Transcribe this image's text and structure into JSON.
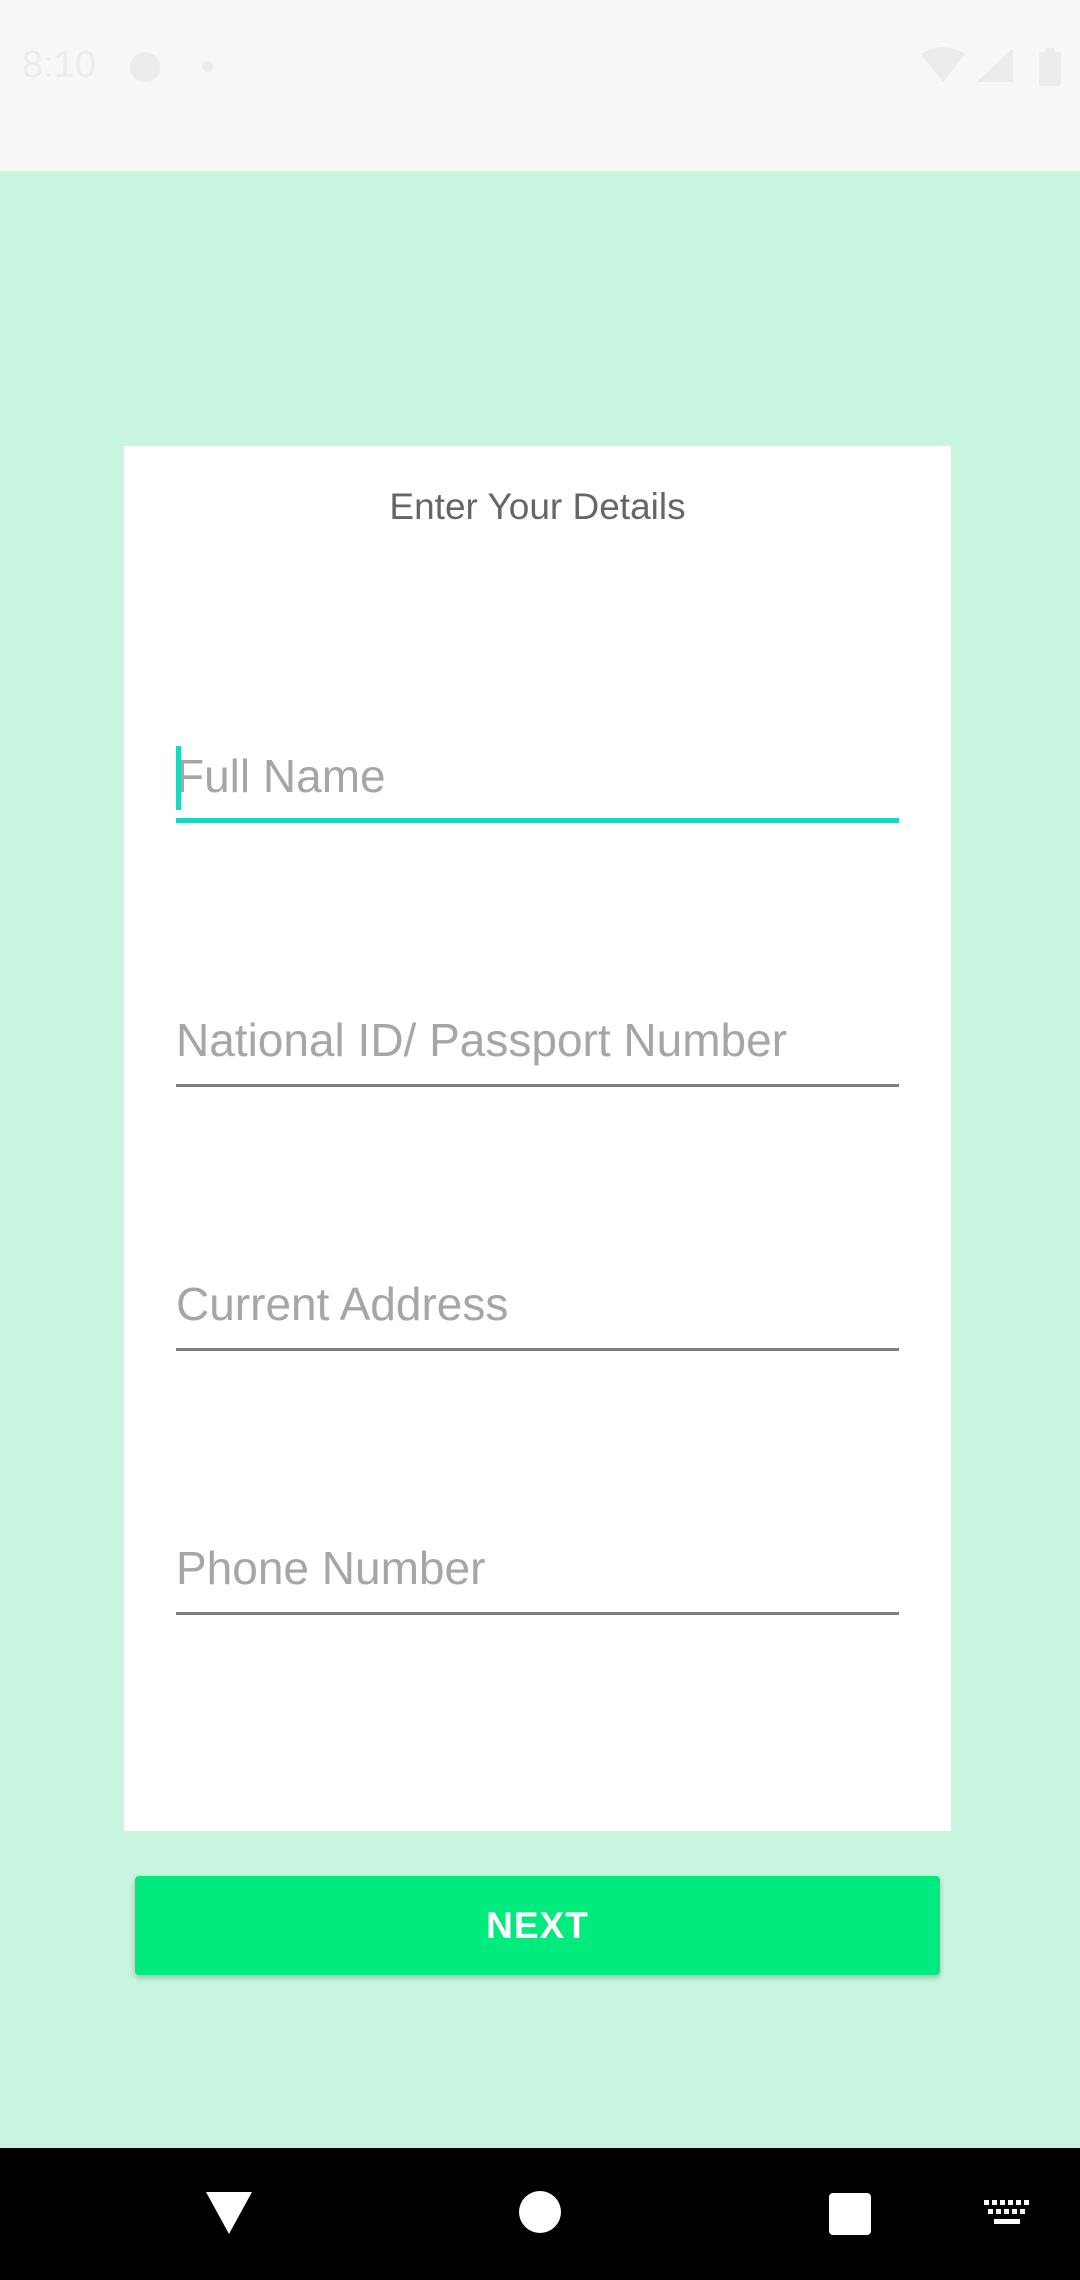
{
  "status_bar": {
    "time": "8:10"
  },
  "form": {
    "title": "Enter Your Details",
    "fields": [
      {
        "placeholder": "Full Name",
        "value": ""
      },
      {
        "placeholder": "National ID/ Passport Number",
        "value": ""
      },
      {
        "placeholder": "Current Address",
        "value": ""
      },
      {
        "placeholder": "Phone Number",
        "value": ""
      }
    ],
    "next_label": "NEXT"
  },
  "colors": {
    "background": "#c8f5df",
    "accent": "#1dd6c2",
    "button": "#00ea7d"
  },
  "icons": {
    "status": [
      "notification-icon",
      "dot-icon",
      "wifi-icon",
      "signal-icon",
      "battery-icon"
    ],
    "nav": [
      "back-icon",
      "home-icon",
      "recents-icon",
      "keyboard-icon"
    ]
  }
}
